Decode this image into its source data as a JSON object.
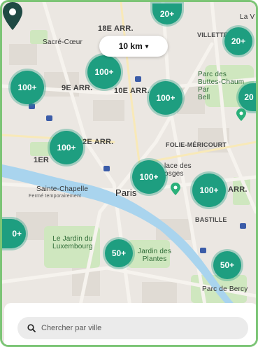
{
  "map": {
    "arrondissements": [
      "18E ARR.",
      "9E ARR.",
      "10E ARR.",
      "2E ARR.",
      "1ER",
      "ARR."
    ],
    "neighborhoods": [
      "VILLETTE",
      "FOLIE-MÉRICOURT",
      "BASTILLE",
      "La V"
    ],
    "landmarks": {
      "sacre_coeur": "Sacré-Cœur",
      "sainte_chapelle": "Sainte-Chapelle",
      "sainte_chapelle_status": "Fermé temporairement",
      "place_des_vosges": "lace des\nosges",
      "parc_buttes": "Parc des\nButtes-Chaum\nPar\nBell",
      "jardin_luxembourg": "Le Jardin du\nLuxembourg",
      "jardin_plantes": "Jardin des\nPlantes",
      "parc_bercy": "Parc de Bercy"
    },
    "city": "Paris"
  },
  "radius_selector": {
    "label": "10 km",
    "chevron": "▾"
  },
  "clusters": [
    "20+",
    "20+",
    "100+",
    "100+",
    "9E",
    "100+",
    "100+",
    "100+",
    "100+",
    "0+",
    "50+",
    "50+",
    "20"
  ],
  "search": {
    "placeholder": "Chercher par ville"
  },
  "colors": {
    "cluster": "#1e9e80",
    "frame": "#7cc576",
    "pin": "#1f4a44",
    "poi": "#2bb07a"
  },
  "icons": [
    "location-pin-icon",
    "park-poi-icon",
    "metro-icon",
    "search-icon",
    "chevron-down-icon"
  ]
}
